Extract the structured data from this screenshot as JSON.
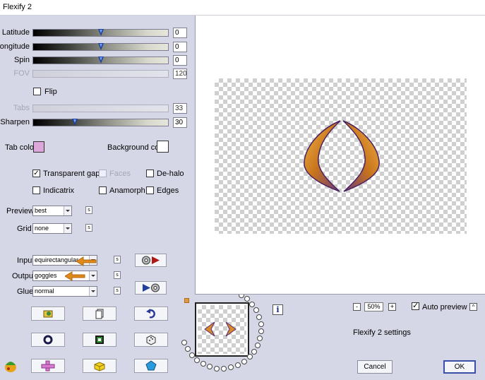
{
  "window": {
    "title": "Flexify 2"
  },
  "sliders": [
    {
      "label": "Latitude",
      "value": "0",
      "level": 0.5,
      "enabled": true
    },
    {
      "label": "Longitude",
      "value": "0",
      "level": 0.5,
      "enabled": true
    },
    {
      "label": "Spin",
      "value": "0",
      "level": 0.5,
      "enabled": true
    },
    {
      "label": "FOV",
      "value": "120",
      "level": 0.0,
      "enabled": false
    },
    {
      "label": "Tabs",
      "value": "33",
      "level": 0.0,
      "enabled": false
    },
    {
      "label": "Sharpen",
      "value": "30",
      "level": 0.3,
      "enabled": true
    }
  ],
  "flip": {
    "label": "Flip",
    "checked": false
  },
  "colors": {
    "tab_color_label": "Tab color",
    "tab_color": "#dfa6d9",
    "background_color_label": "Background color",
    "background_color": "#ffffff"
  },
  "options": {
    "transparent_gaps": {
      "label": "Transparent gaps",
      "checked": true
    },
    "faces": {
      "label": "Faces",
      "checked": false,
      "enabled": false
    },
    "de_halo": {
      "label": "De-halo",
      "checked": false
    },
    "indicatrix": {
      "label": "Indicatrix",
      "checked": false
    },
    "anamorph": {
      "label": "Anamorph",
      "checked": false
    },
    "edges": {
      "label": "Edges",
      "checked": false
    }
  },
  "preview_mode": {
    "label": "Preview",
    "value": "best",
    "s_label": "s"
  },
  "grid": {
    "label": "Grid",
    "value": "none",
    "s_label": "s"
  },
  "projection": {
    "input_label": "Input",
    "input_value": "equirectangular",
    "output_label": "Output",
    "output_value": "goggles",
    "glue_label": "Glue",
    "glue_value": "normal",
    "s_label": "s"
  },
  "info_button": "i",
  "zoom": {
    "minus": "-",
    "value": "50%",
    "plus": "+"
  },
  "auto_preview": {
    "label": "Auto preview",
    "checked": true,
    "collapse": "^"
  },
  "status_text": "Flexify 2 settings",
  "buttons": {
    "cancel": "Cancel",
    "ok": "OK"
  },
  "accent_colors": {
    "arrow": "#e08a1c",
    "shape_orange": "#d98a2a",
    "shape_purple": "#5a2a6e",
    "thumb": "#1f3f9a"
  }
}
